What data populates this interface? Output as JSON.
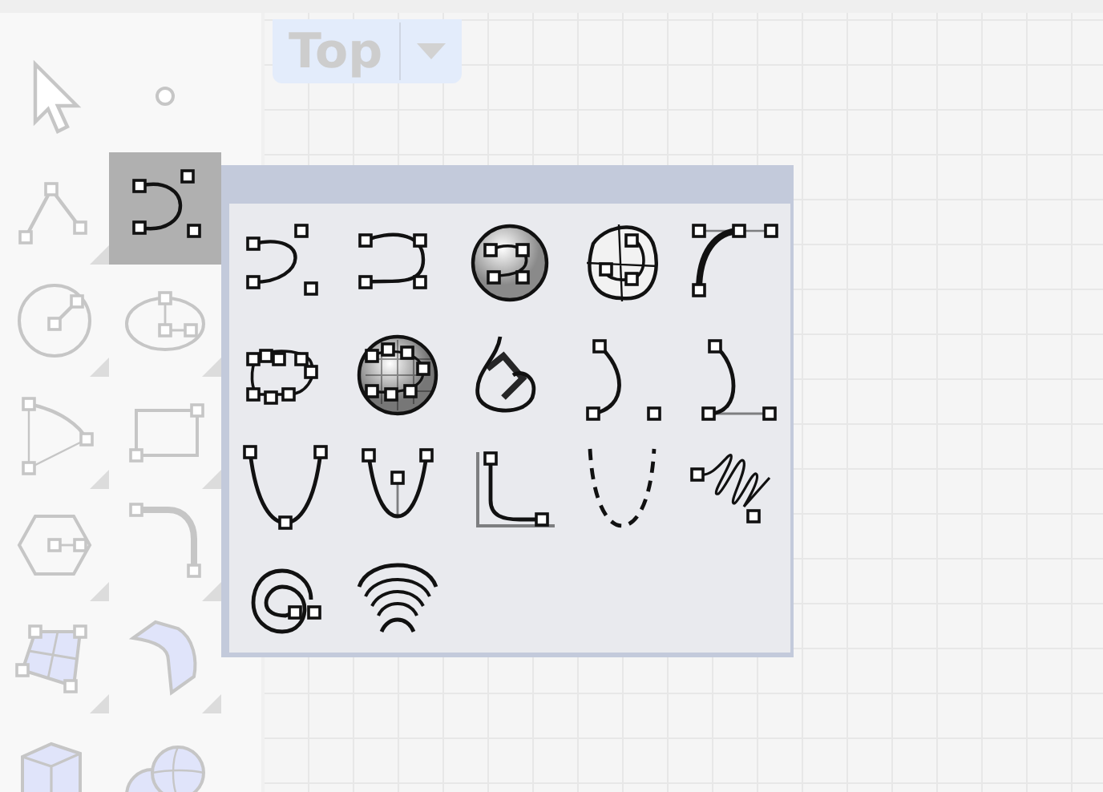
{
  "viewport": {
    "title": "Top"
  },
  "toolbar": {
    "tools": [
      {
        "kind": "select",
        "selected": false
      },
      {
        "kind": "point",
        "selected": false
      },
      {
        "kind": "polyline",
        "selected": false
      },
      {
        "kind": "curve",
        "selected": true
      },
      {
        "kind": "circle",
        "selected": false
      },
      {
        "kind": "ellipse",
        "selected": false
      },
      {
        "kind": "arc",
        "selected": false
      },
      {
        "kind": "rectangle",
        "selected": false
      },
      {
        "kind": "polygon",
        "selected": false
      },
      {
        "kind": "fillet",
        "selected": false
      },
      {
        "kind": "patch",
        "selected": false
      },
      {
        "kind": "bent-surface",
        "selected": false
      },
      {
        "kind": "box",
        "selected": false
      },
      {
        "kind": "spheres",
        "selected": false
      }
    ]
  },
  "flyout": {
    "tools": [
      {
        "kind": "curve-cp"
      },
      {
        "kind": "curve-ip"
      },
      {
        "kind": "sphere-curve"
      },
      {
        "kind": "surface-curve"
      },
      {
        "kind": "blend-arc"
      },
      {
        "kind": "closed-curve"
      },
      {
        "kind": "grid-sphere"
      },
      {
        "kind": "sketch"
      },
      {
        "kind": "handle-curve"
      },
      {
        "kind": "tangent-curve"
      },
      {
        "kind": "parabola"
      },
      {
        "kind": "parabola-focus"
      },
      {
        "kind": "corner"
      },
      {
        "kind": "dashed"
      },
      {
        "kind": "helix"
      },
      {
        "kind": "spiral"
      },
      {
        "kind": "arcs"
      }
    ]
  }
}
